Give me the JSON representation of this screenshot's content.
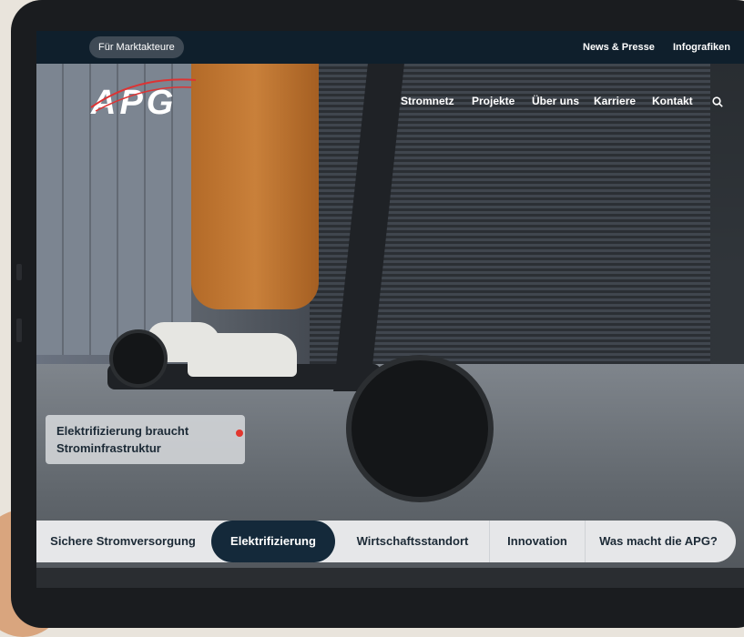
{
  "topbar": {
    "pill_label": "Für Marktakteure",
    "links": [
      "News & Presse",
      "Infografiken"
    ]
  },
  "header": {
    "logo_text": "APG",
    "nav": [
      "Stromnetz",
      "Projekte",
      "Über uns",
      "Karriere",
      "Kontakt"
    ],
    "search_icon": "search-icon"
  },
  "hero": {
    "caption": "Elektrifizierung braucht Strominfrastruktur"
  },
  "tabs": [
    {
      "label": "Sichere Stromversorgung"
    },
    {
      "label": "Elektrifizierung",
      "active": true
    },
    {
      "label": "Wirtschaftsstandort"
    },
    {
      "label": "Innovation"
    },
    {
      "label": "Was macht die APG?"
    }
  ],
  "colors": {
    "topbar": "#0f1f2c",
    "accent_dot": "#e2372f",
    "active_tab": "#14293a"
  }
}
